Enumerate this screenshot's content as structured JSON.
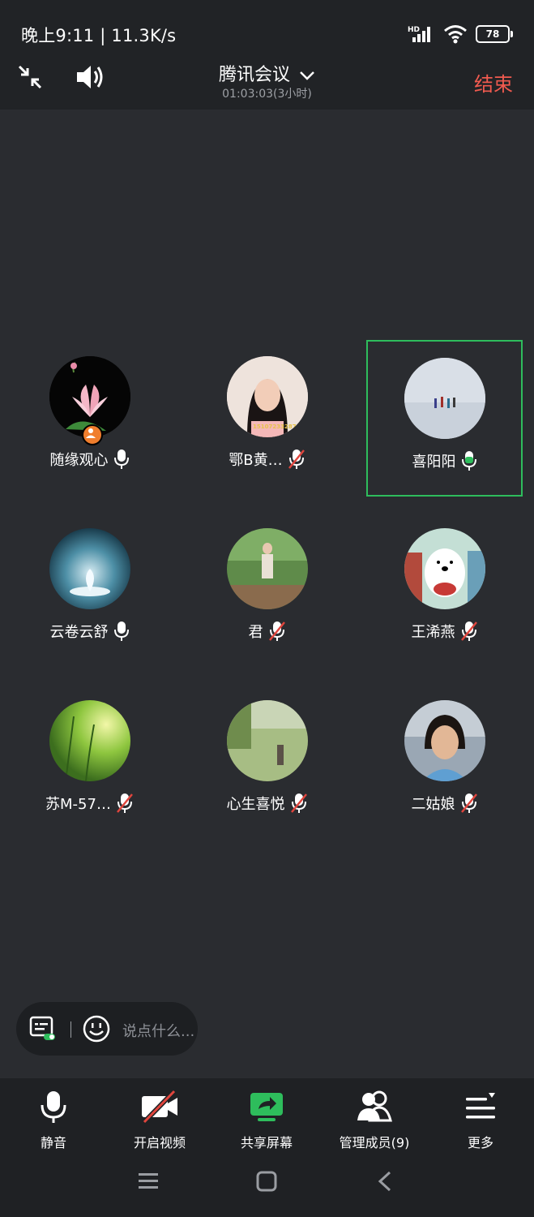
{
  "status": {
    "time": "晚上9:11 | 11.3K/s",
    "battery": "78"
  },
  "header": {
    "title": "腾讯会议",
    "duration": "01:03:03(3小时)",
    "end_label": "结束"
  },
  "participants": [
    {
      "name": "随缘观心",
      "mic": "on"
    },
    {
      "name": "鄂B黄…",
      "mic": "muted"
    },
    {
      "name": "喜阳阳",
      "mic": "speaking"
    },
    {
      "name": "云卷云舒",
      "mic": "on"
    },
    {
      "name": "君",
      "mic": "muted"
    },
    {
      "name": "王浠燕",
      "mic": "muted"
    },
    {
      "name": "苏M-57…",
      "mic": "muted"
    },
    {
      "name": "心生喜悦",
      "mic": "muted"
    },
    {
      "name": "二姑娘",
      "mic": "muted"
    }
  ],
  "chat": {
    "placeholder": "说点什么..."
  },
  "toolbar": {
    "mute": "静音",
    "video": "开启视频",
    "share": "共享屏幕",
    "members": "管理成员(9)",
    "more": "更多"
  },
  "colors": {
    "accent_green": "#2ebd5c",
    "end_red": "#f05a4f",
    "muted_red": "#e0453d"
  }
}
